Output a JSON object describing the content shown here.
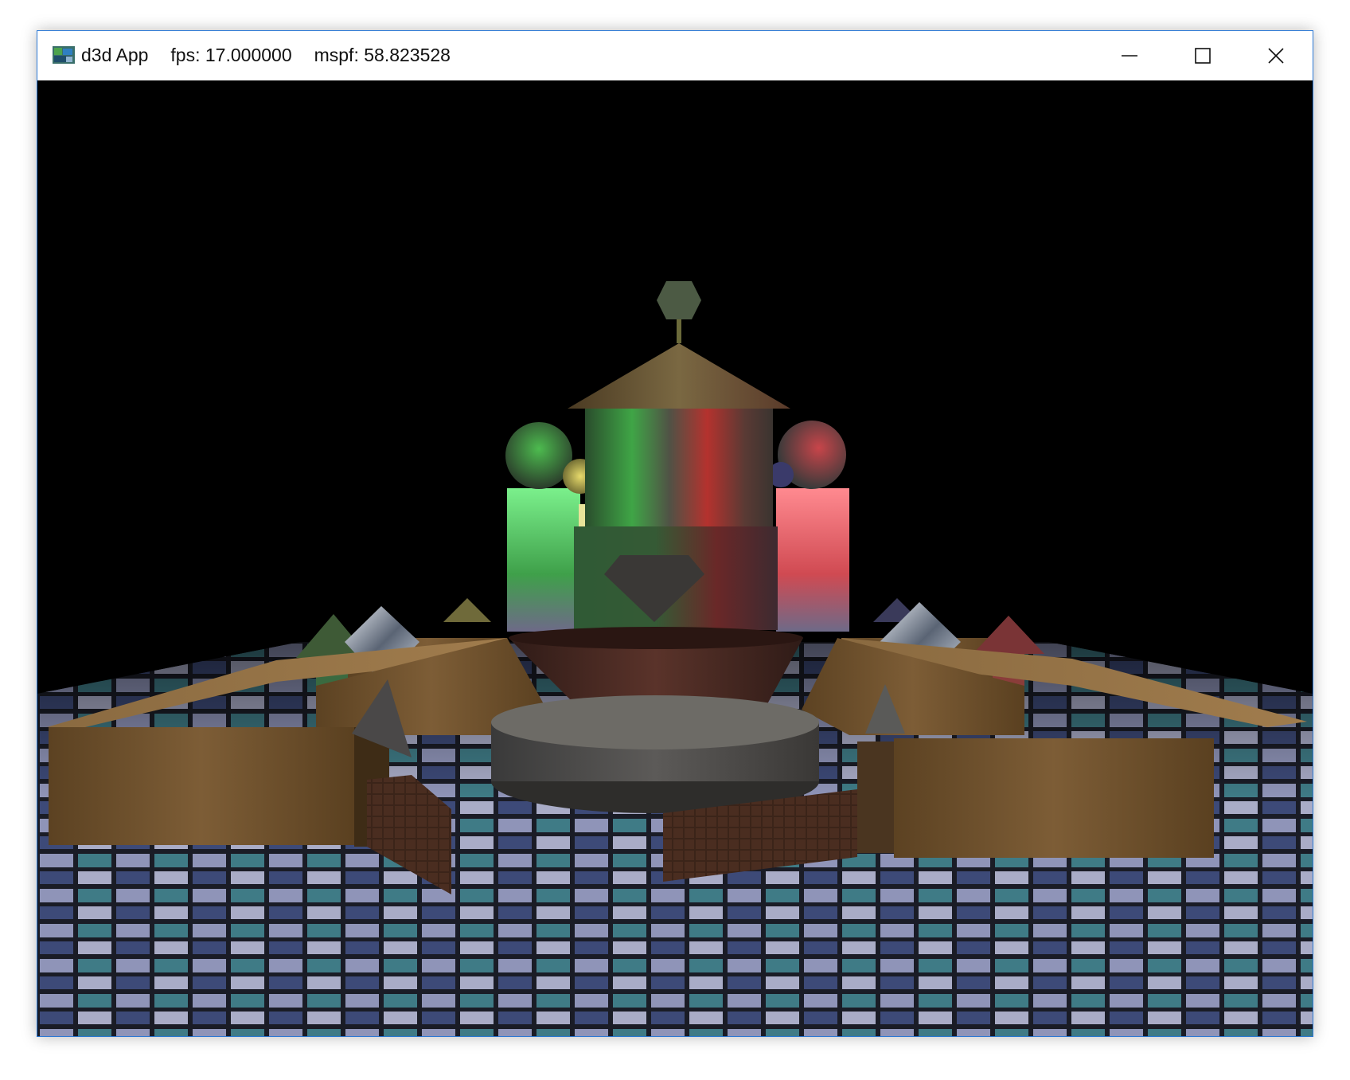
{
  "window": {
    "app_name": "d3d App",
    "fps": "fps: 17.000000",
    "mspf": "mspf: 58.823528",
    "minimize_icon": "minimize-icon",
    "maximize_icon": "maximize-icon",
    "close_icon": "close-icon"
  },
  "scene": {
    "description_icon": "3d-scene",
    "colors": {
      "background": "#000000",
      "wood": "#7a5a34",
      "stone": "#6a6a6a",
      "brick": "#3a2218",
      "bowl": "#4a2a22",
      "green_light": "#37d94a",
      "red_light": "#e13a3a"
    }
  }
}
